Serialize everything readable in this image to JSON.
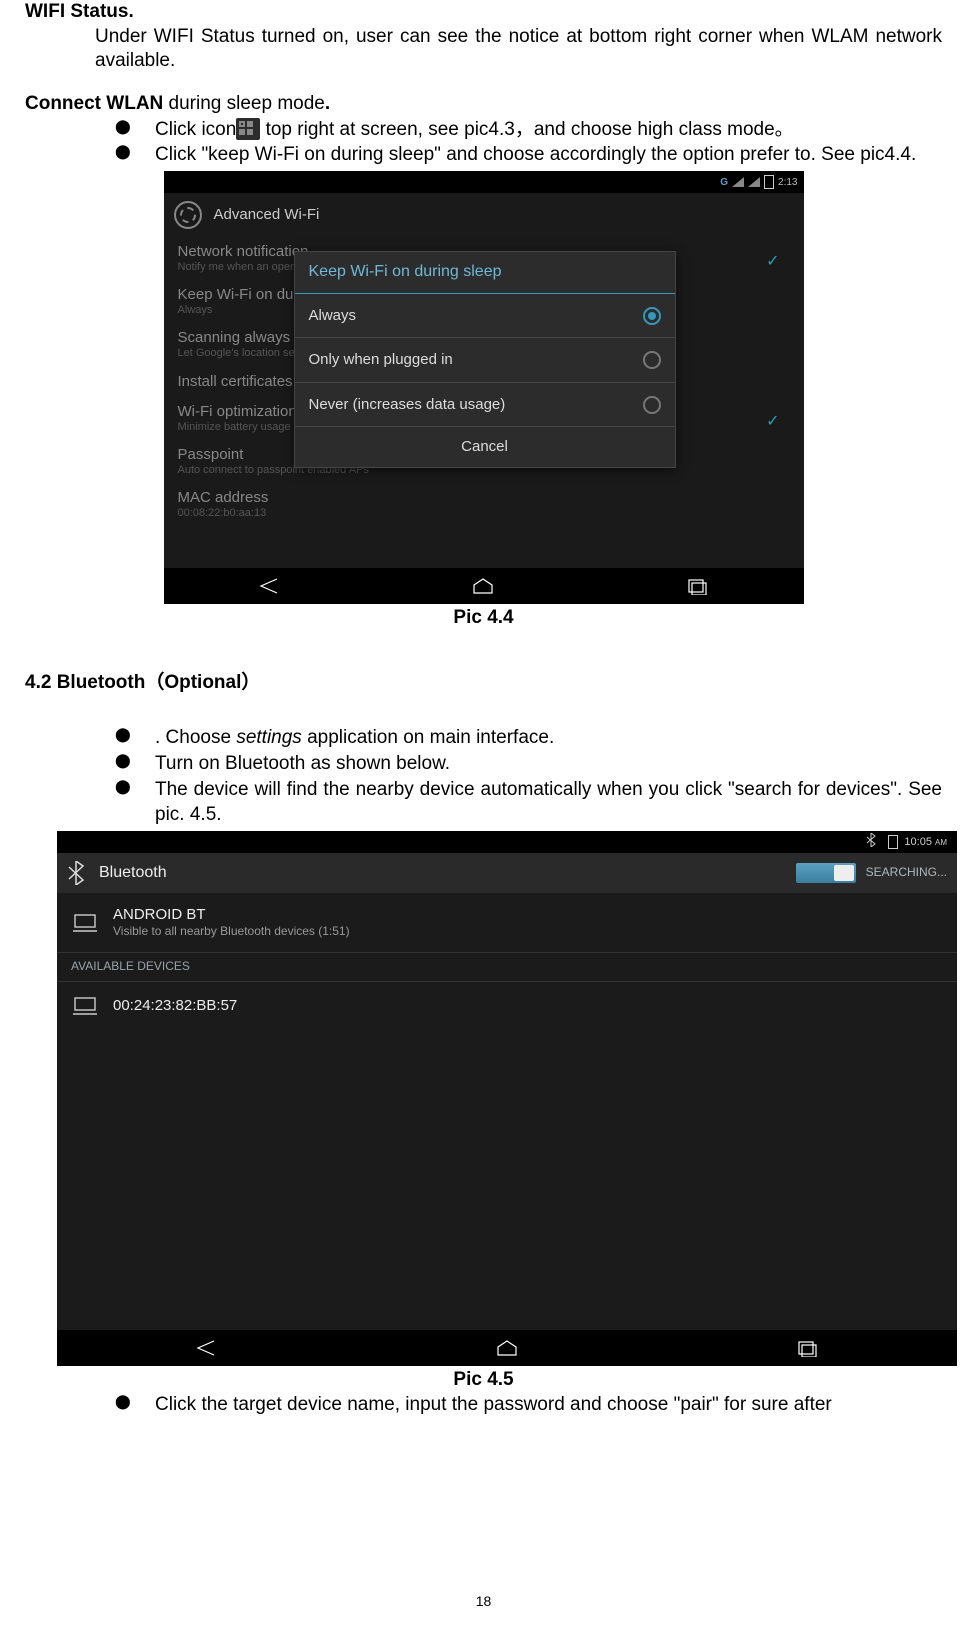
{
  "title_wifi_status": "WIFI Status.",
  "wifi_status_body": "Under WIFI Status turned on, user can see the notice at bottom right corner when WLAM network available.",
  "title_connect_wlan_prefix": "Connect WLAN",
  "title_connect_wlan_rest": " during sleep mode",
  "title_connect_wlan_dot": ".",
  "bullet1_a": "Click icon",
  "bullet1_b": " top right at screen, see pic4.3，and choose high class mode。",
  "bullet2": " Click \"keep Wi-Fi on during sleep\" and choose accordingly the option prefer to. See pic4.4.",
  "shot1": {
    "status_time": "2:13",
    "gsymbol": "G",
    "header": "Advanced Wi-Fi",
    "items": {
      "net_notif_t": "Network notification",
      "net_notif_s": "Notify me when an open network is available",
      "keep_wifi_t": "Keep Wi-Fi on durin",
      "keep_wifi_s": "Always",
      "scan_t": "Scanning always a",
      "scan_s": "Let Google's location se",
      "install_t": "Install certificates",
      "wifiopt_t": "Wi-Fi optimization",
      "wifiopt_s": "Minimize battery usage",
      "passpoint_t": "Passpoint",
      "passpoint_s": "Auto connect to passpoint enabled APs",
      "mac_t": "MAC address",
      "mac_s": "00:08:22:b0:aa:13"
    },
    "dialog": {
      "title": "Keep Wi-Fi on during sleep",
      "opt_always": "Always",
      "opt_plugged": "Only when plugged in",
      "opt_never": "Never (increases data usage)",
      "cancel": "Cancel"
    }
  },
  "caption1": "Pic 4.4",
  "title_42": "4.2 Bluetooth（Optional）",
  "b42_1_a": ". Choose ",
  "b42_1_b": "settings",
  "b42_1_c": " application on main interface.",
  "b42_2": "  Turn on Bluetooth as shown below.",
  "b42_3": "  The device will find the nearby device automatically when you click \"search for devices\". See pic. 4.5.",
  "shot2": {
    "time": "10:05",
    "ampm": "AM",
    "title": "Bluetooth",
    "searching": "SEARCHING...",
    "own_name": "ANDROID BT",
    "own_sub": "Visible to all nearby Bluetooth devices (1:51)",
    "avail_label": "AVAILABLE DEVICES",
    "dev1": "00:24:23:82:BB:57"
  },
  "caption2": "Pic 4.5",
  "bullet_last": "Click the target device name, input the password and choose \"pair\" for sure after",
  "page_number": "18"
}
